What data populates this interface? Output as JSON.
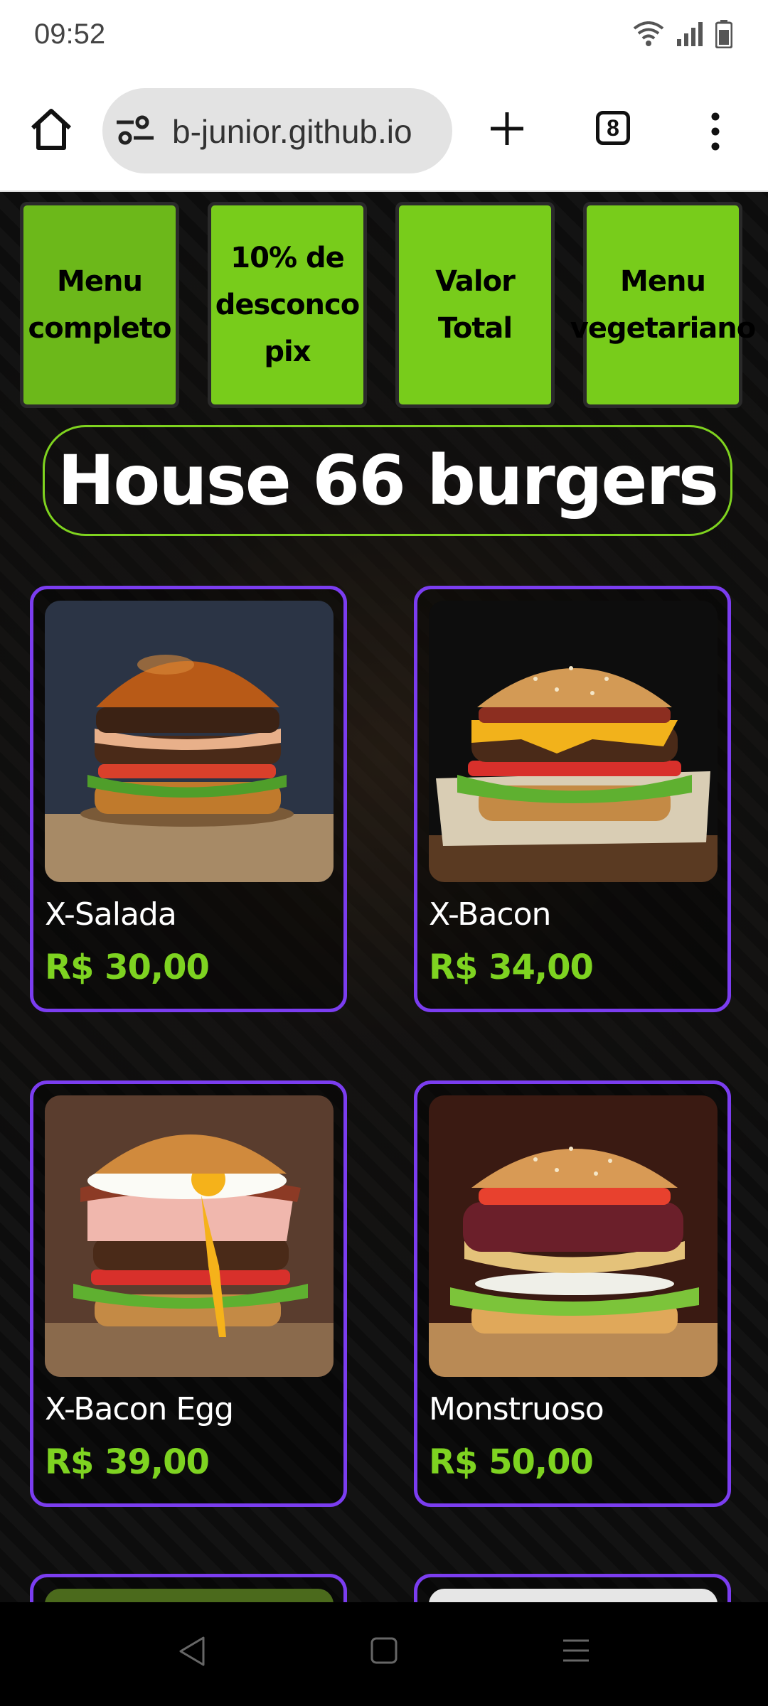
{
  "status_bar": {
    "time": "09:52"
  },
  "browser": {
    "url": "b-junior.github.io",
    "tab_count": "8"
  },
  "nav_buttons": [
    {
      "label": "Menu completo"
    },
    {
      "label": "10% de desconco pix"
    },
    {
      "label": "Valor Total"
    },
    {
      "label": "Menu vegetariano"
    }
  ],
  "brand": {
    "title": "House 66 burgers"
  },
  "products": [
    {
      "name": "X-Salada",
      "price": "R$ 30,00"
    },
    {
      "name": "X-Bacon",
      "price": "R$ 34,00"
    },
    {
      "name": "X-Bacon Egg",
      "price": "R$ 39,00"
    },
    {
      "name": "Monstruoso",
      "price": "R$ 50,00"
    }
  ],
  "colors": {
    "accent_green": "#78cc1b",
    "card_border": "#7b3df0",
    "price_green": "#7ed321"
  }
}
